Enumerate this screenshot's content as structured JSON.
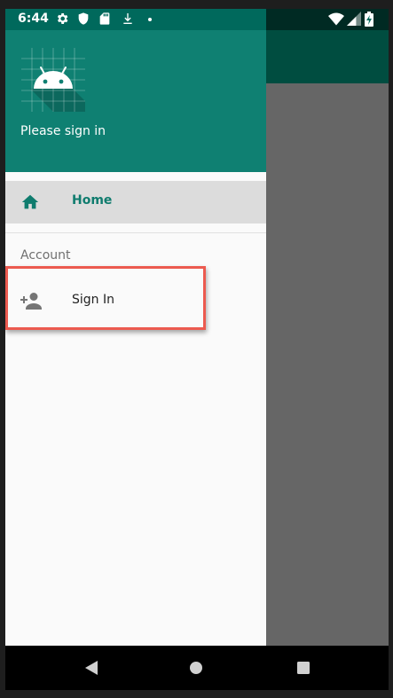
{
  "status_bar": {
    "time": "6:44",
    "icons": [
      "settings-icon",
      "shield-icon",
      "sd-card-icon",
      "download-icon",
      "dot-icon"
    ],
    "right_icons": [
      "wifi-icon",
      "signal-icon",
      "battery-charging-icon"
    ]
  },
  "drawer": {
    "header": {
      "logo": "android-logo-icon",
      "text": "Please sign in"
    },
    "items": [
      {
        "label": "Home",
        "icon": "home-icon",
        "selected": true
      }
    ],
    "sections": [
      {
        "title": "Account",
        "items": [
          {
            "label": "Sign In",
            "icon": "person-add-icon",
            "highlighted": true
          }
        ]
      }
    ]
  },
  "nav_bar": {
    "buttons": [
      "back-icon",
      "home-circle-icon",
      "recents-icon"
    ]
  },
  "colors": {
    "header": "#0f8072",
    "accent": "#0f7c6e",
    "highlight": "#ec5a4f",
    "status_bar": "#00695c"
  }
}
